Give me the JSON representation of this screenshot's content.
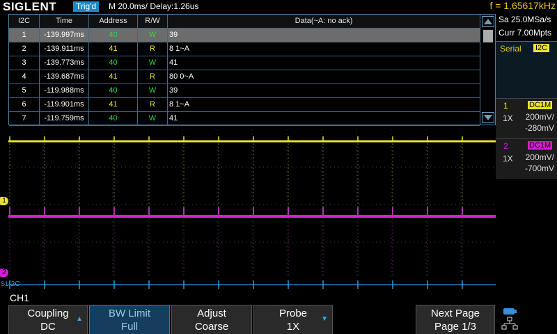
{
  "topbar": {
    "logo": "SIGLENT",
    "trigger_status": "Trig'd",
    "timebase": "M 20.0ms/ Delay:1.26us",
    "frequency": "f = 1.65617kHz"
  },
  "table": {
    "headers": [
      "I2C",
      "Time",
      "Address",
      "R/W",
      "Data(~A: no ack)"
    ],
    "rows": [
      {
        "idx": "1",
        "time": "-139.997ms",
        "addr": "40",
        "rw": "W",
        "data": "39"
      },
      {
        "idx": "2",
        "time": "-139.911ms",
        "addr": "41",
        "rw": "R",
        "data": "8 1~A"
      },
      {
        "idx": "3",
        "time": "-139.773ms",
        "addr": "40",
        "rw": "W",
        "data": "41"
      },
      {
        "idx": "4",
        "time": "-139.687ms",
        "addr": "41",
        "rw": "R",
        "data": "80 0~A"
      },
      {
        "idx": "5",
        "time": "-119.988ms",
        "addr": "40",
        "rw": "W",
        "data": "39"
      },
      {
        "idx": "6",
        "time": "-119.901ms",
        "addr": "41",
        "rw": "R",
        "data": "8 1~A"
      },
      {
        "idx": "7",
        "time": "-119.759ms",
        "addr": "40",
        "rw": "W",
        "data": "41"
      }
    ],
    "selected_row": 1
  },
  "right_panel": {
    "sample_rate": "Sa 25.0MSa/s",
    "memory_depth": "Curr 7.00Mpts",
    "serial_label": "Serial",
    "serial_badge": "I2C",
    "ch1": {
      "num": "1",
      "coupling": "DC1M",
      "probe": "1X",
      "scale": "200mV/",
      "offset": "-280mV",
      "color": "#e8e22c"
    },
    "ch2": {
      "num": "2",
      "coupling": "DC1M",
      "probe": "1X",
      "scale": "200mV/",
      "offset": "-700mV",
      "color": "#d41ed4"
    }
  },
  "scope": {
    "ch1_marker": "1",
    "ch2_marker": "2",
    "s1_marker": "S1",
    "bus_label": "I2C"
  },
  "bottom": {
    "menu_title": "CH1",
    "softkeys": [
      {
        "line1": "Coupling",
        "line2": "DC"
      },
      {
        "line1": "BW Limit",
        "line2": "Full"
      },
      {
        "line1": "Adjust",
        "line2": "Coarse"
      },
      {
        "line1": "Probe",
        "line2": "1X"
      },
      {
        "line1": "Next Page",
        "line2": "Page 1/3"
      }
    ]
  },
  "icons": [
    "scroll-up-icon",
    "scroll-down-icon",
    "trigger-position-icon",
    "usb-icon",
    "network-icon"
  ]
}
